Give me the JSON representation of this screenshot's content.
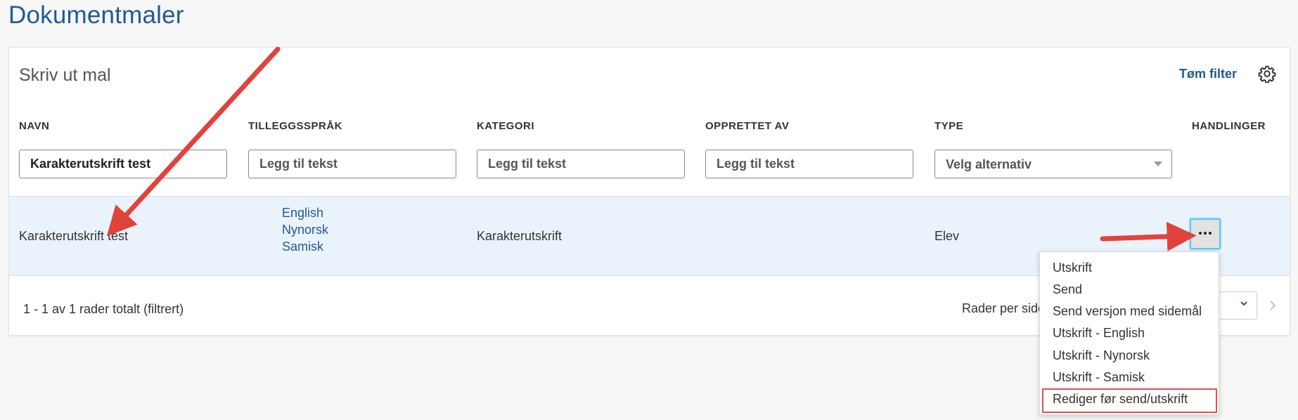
{
  "page": {
    "title": "Dokumentmaler"
  },
  "card": {
    "title": "Skriv ut mal",
    "clear_filter": "Tøm filter",
    "settings_icon": "gear-icon"
  },
  "columns": [
    {
      "key": "navn",
      "label": "NAVN"
    },
    {
      "key": "tilleggssprak",
      "label": "TILLEGGSSPRÅK"
    },
    {
      "key": "kategori",
      "label": "KATEGORI"
    },
    {
      "key": "opprettet_av",
      "label": "OPPRETTET AV"
    },
    {
      "key": "type",
      "label": "TYPE"
    },
    {
      "key": "handlinger",
      "label": "HANDLINGER"
    }
  ],
  "filters": {
    "navn": {
      "value": "Karakterutskrift test",
      "placeholder": "Legg til tekst"
    },
    "tilleggssprak": {
      "value": "",
      "placeholder": "Legg til tekst"
    },
    "kategori": {
      "value": "",
      "placeholder": "Legg til tekst"
    },
    "opprettet_av": {
      "value": "",
      "placeholder": "Legg til tekst"
    },
    "type": {
      "selected": "Velg alternativ"
    }
  },
  "rows": [
    {
      "navn": "Karakterutskrift test",
      "languages": [
        "English",
        "Nynorsk",
        "Samisk"
      ],
      "kategori": "Karakterutskrift",
      "opprettet_av": "",
      "type": "Elev",
      "actions_icon": "more-dots-icon"
    }
  ],
  "footer": {
    "count": "1 - 1 av 1 rader totalt (filtrert)",
    "rows_per_page": "Rader per side"
  },
  "actions_menu": {
    "items": [
      "Utskrift",
      "Send",
      "Send versjon med sidemål",
      "Utskrift - English",
      "Utskrift - Nynorsk",
      "Utskrift - Samisk",
      "Rediger før send/utskrift"
    ],
    "highlighted": "Rediger før send/utskrift"
  },
  "colors": {
    "brand": "#1f5a96",
    "row_highlight": "#eaf3fc",
    "annotation_arrow": "#e0433b",
    "focus": "#5bc4f1"
  }
}
